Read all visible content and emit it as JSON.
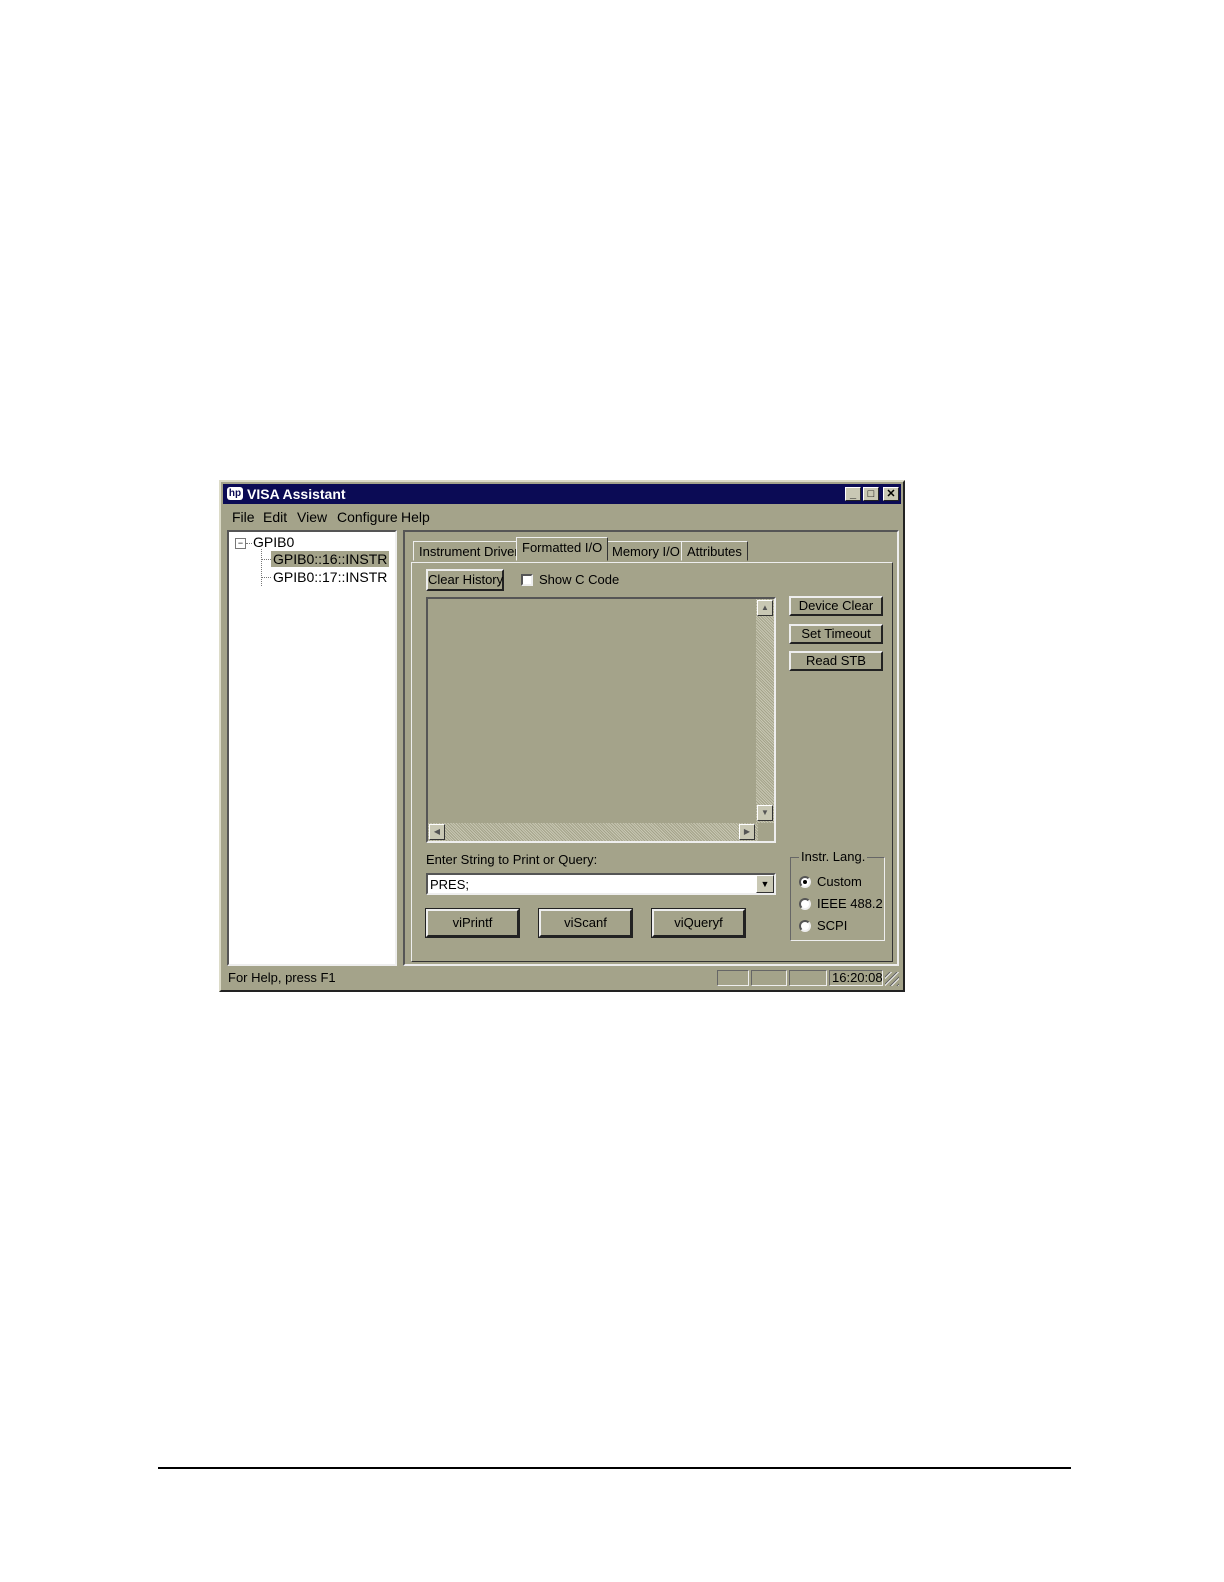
{
  "window": {
    "title": "VISA Assistant",
    "icon": "hp-logo-icon",
    "controls": [
      "_",
      "□",
      "✕"
    ]
  },
  "menu": [
    "File",
    "Edit",
    "View",
    "Configure",
    "Help"
  ],
  "tree": {
    "root": "GPIB0",
    "root_toggle": "−",
    "children": [
      "GPIB0::16::INSTR",
      "GPIB0::17::INSTR"
    ],
    "selected": "GPIB0::16::INSTR"
  },
  "tabs": [
    "Instrument Driver",
    "Formatted I/O",
    "Memory I/O",
    "Attributes"
  ],
  "active_tab": "Formatted I/O",
  "formatted_io": {
    "clear_history": "Clear History",
    "show_c_code": "Show C Code",
    "show_c_code_checked": false,
    "side_buttons": [
      "Device Clear",
      "Set Timeout",
      "Read STB"
    ],
    "input_label": "Enter String to Print or Query:",
    "input_value": "PRES;",
    "action_buttons": [
      "viPrintf",
      "viScanf",
      "viQueryf"
    ],
    "instr_lang": {
      "label": "Instr. Lang.",
      "options": [
        "Custom",
        "IEEE 488.2",
        "SCPI"
      ],
      "selected": "Custom"
    }
  },
  "status": {
    "help_text": "For Help, press F1",
    "time": "16:20:08"
  },
  "colors": {
    "window_bg": "#a4a38a",
    "titlebar_bg": "#0b0b55",
    "titlebar_text": "#ffffff"
  }
}
